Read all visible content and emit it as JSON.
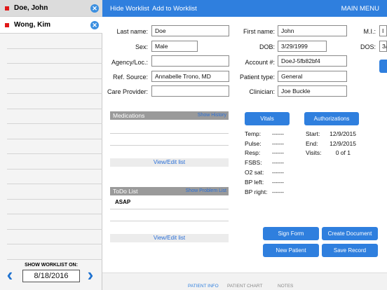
{
  "sidebar": {
    "patients": [
      {
        "name": "Doe, John"
      },
      {
        "name": "Wong, Kim"
      }
    ],
    "worklist_label": "SHOW WORKLIST ON:",
    "worklist_date": "8/18/2016"
  },
  "topbar": {
    "hide_worklist": "Hide Worklist",
    "add_to_worklist": "Add to Worklist",
    "main_menu": "MAIN MENU"
  },
  "form": {
    "last_name": {
      "label": "Last name:",
      "value": "Doe"
    },
    "sex": {
      "label": "Sex:",
      "value": "Male"
    },
    "agency": {
      "label": "Agency/Loc.:",
      "value": ""
    },
    "ref_source": {
      "label": "Ref. Source:",
      "value": "Annabelle Trono, MD"
    },
    "care_provider": {
      "label": "Care Provider:",
      "value": ""
    },
    "first_name": {
      "label": "First name:",
      "value": "John"
    },
    "dob": {
      "label": "DOB:",
      "value": "3/29/1999"
    },
    "account": {
      "label": "Account #:",
      "value": "DoeJ-5fb82bf4"
    },
    "patient_type": {
      "label": "Patient type:",
      "value": "General"
    },
    "clinician": {
      "label": "Clinician:",
      "value": "Joe Buckle"
    },
    "mi": {
      "label": "M.I.:",
      "value": "I"
    },
    "dos": {
      "label": "DOS:",
      "value": "3/"
    }
  },
  "medications": {
    "title": "Medications",
    "show_history": "Show History",
    "view_edit": "View/Edit list"
  },
  "todo": {
    "title": "ToDo List",
    "show_problem_list": "Show Problem List",
    "items": [
      "ASAP"
    ],
    "view_edit": "View/Edit list"
  },
  "vitals": {
    "button": "Vitals",
    "rows": [
      {
        "label": "Temp:",
        "value": "------"
      },
      {
        "label": "Pulse:",
        "value": "------"
      },
      {
        "label": "Resp:",
        "value": "------"
      },
      {
        "label": "FSBS:",
        "value": "------"
      },
      {
        "label": "O2 sat:",
        "value": "------"
      },
      {
        "label": "BP left:",
        "value": "------"
      },
      {
        "label": "BP right:",
        "value": "------"
      }
    ]
  },
  "authorizations": {
    "button": "Authorizations",
    "start_label": "Start:",
    "start_value": "12/9/2015",
    "end_label": "End:",
    "end_value": "12/9/2015",
    "visits_label": "Visits:",
    "visits_value": "0 of 1"
  },
  "actions": {
    "sign_form": "Sign Form",
    "create_document": "Create Document",
    "new_patient": "New Patient",
    "save_record": "Save Record"
  },
  "bottom_tabs": {
    "patient_info": "PATIENT INFO",
    "patient_chart": "PATIENT CHART",
    "notes": "NOTES"
  },
  "colors": {
    "accent": "#2f7fde",
    "selected_marker": "#e01818"
  }
}
